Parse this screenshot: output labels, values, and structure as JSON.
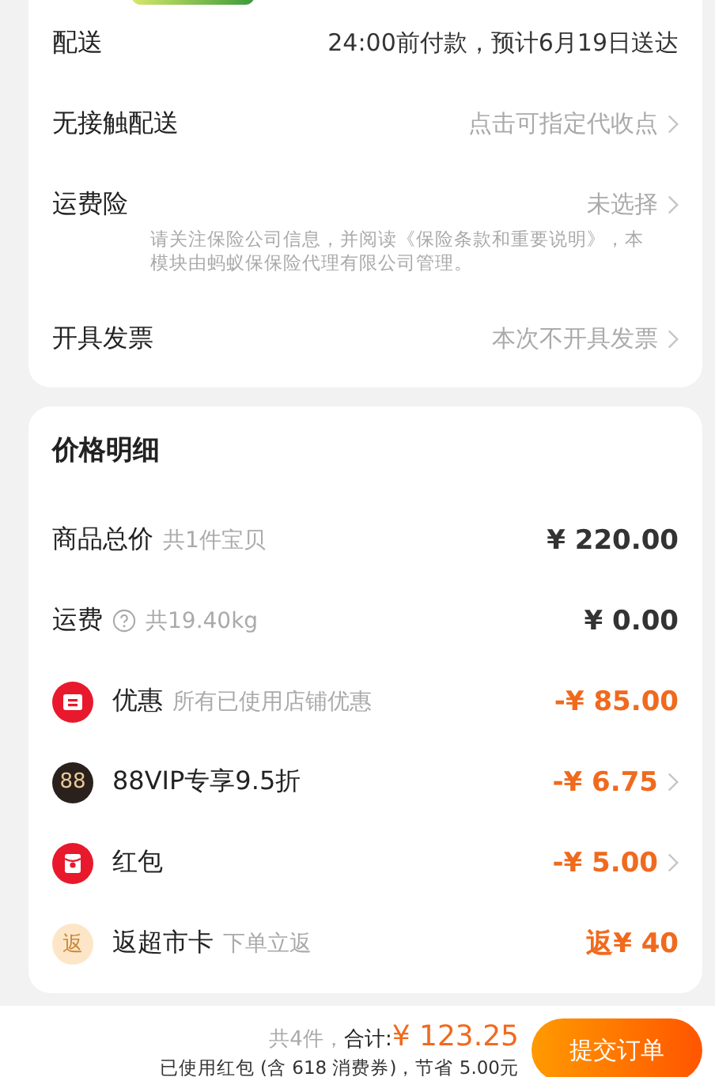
{
  "delivery_card": {
    "rows": [
      {
        "label": "配送",
        "value": "24:00前付款，预计6月19日送达",
        "kind": "info",
        "chevron": false
      },
      {
        "label": "无接触配送",
        "value": "点击可指定代收点",
        "kind": "link",
        "chevron": true
      },
      {
        "label": "运费险",
        "value": "未选择",
        "kind": "link",
        "chevron": true,
        "note": "请关注保险公司信息，并阅读《保险条款和重要说明》，本模块由蚂蚁保保险代理有限公司管理。"
      },
      {
        "label": "开具发票",
        "value": "本次不开具发票",
        "kind": "link",
        "chevron": true
      }
    ]
  },
  "price_card": {
    "title": "价格明细",
    "rows": [
      {
        "kind": "plain",
        "label": "商品总价",
        "sub": "共1件宝贝",
        "amount": "¥ 220.00",
        "discount": false,
        "chevron": false,
        "help": false
      },
      {
        "kind": "plain",
        "label": "运费",
        "sub": "共19.40kg",
        "amount": "¥ 0.00",
        "discount": false,
        "chevron": false,
        "help": true
      },
      {
        "kind": "coupon",
        "label": "优惠",
        "sub": "所有已使用店铺优惠",
        "amount": "-¥ 85.00",
        "discount": true,
        "chevron": false,
        "help": false
      },
      {
        "kind": "vip",
        "icon_text": "88",
        "label": "88VIP专享9.5折",
        "amount": "-¥ 6.75",
        "discount": true,
        "chevron": true,
        "help": false
      },
      {
        "kind": "envelope",
        "label": "红包",
        "amount": "-¥ 5.00",
        "discount": true,
        "chevron": true,
        "help": false
      },
      {
        "kind": "rebate",
        "icon_text": "返",
        "label": "返超市卡",
        "sub": "下单立返",
        "amount": "返¥ 40",
        "discount": true,
        "chevron": false,
        "help": false
      }
    ]
  },
  "footer": {
    "count": "共4件，",
    "total_label": "合计:",
    "total": "¥ 123.25",
    "note": "已使用红包 (含 618 消费券)，节省 5.00元",
    "submit": "提交订单"
  }
}
